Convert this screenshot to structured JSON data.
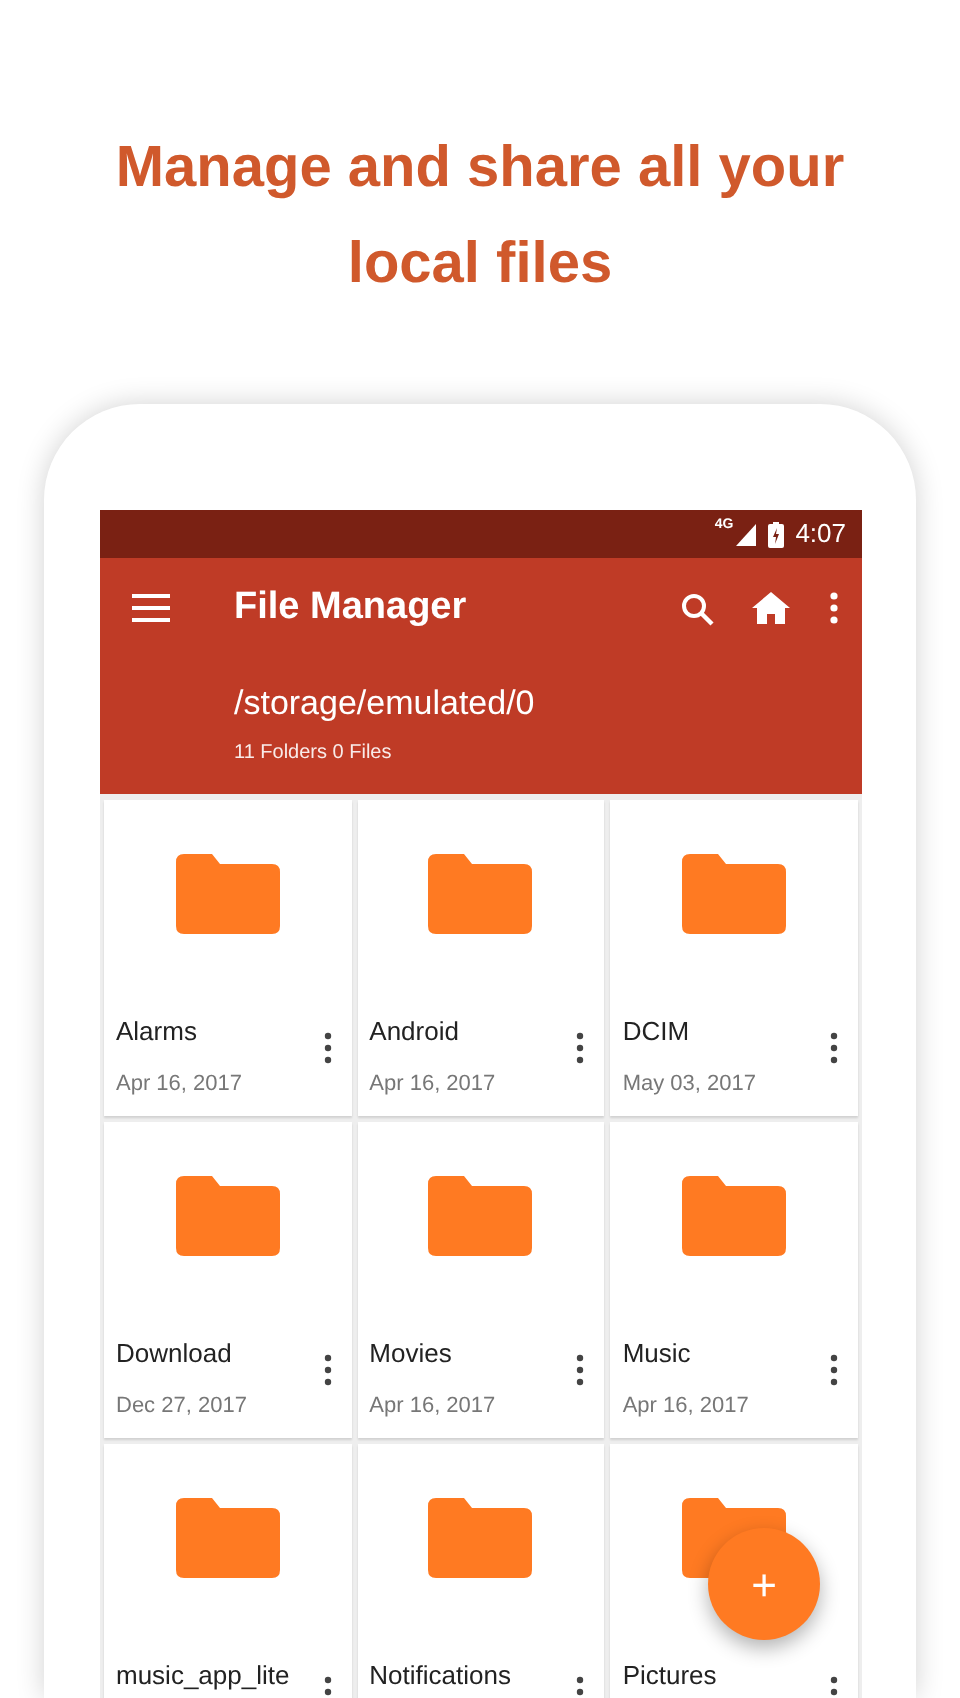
{
  "headline": "Manage and share all your local files",
  "status_bar": {
    "network": "4G",
    "time": "4:07"
  },
  "app_bar": {
    "title": "File Manager",
    "path": "/storage/emulated/0",
    "summary": "11 Folders 0 Files"
  },
  "folders": [
    {
      "name": "Alarms",
      "date": "Apr 16, 2017"
    },
    {
      "name": "Android",
      "date": "Apr 16, 2017"
    },
    {
      "name": "DCIM",
      "date": "May 03, 2017"
    },
    {
      "name": "Download",
      "date": "Dec 27, 2017"
    },
    {
      "name": "Movies",
      "date": "Apr 16, 2017"
    },
    {
      "name": "Music",
      "date": "Apr 16, 2017"
    },
    {
      "name": "music_app_lite"
    },
    {
      "name": "Notifications"
    },
    {
      "name": "Pictures"
    }
  ],
  "fab": {
    "label": "+"
  }
}
